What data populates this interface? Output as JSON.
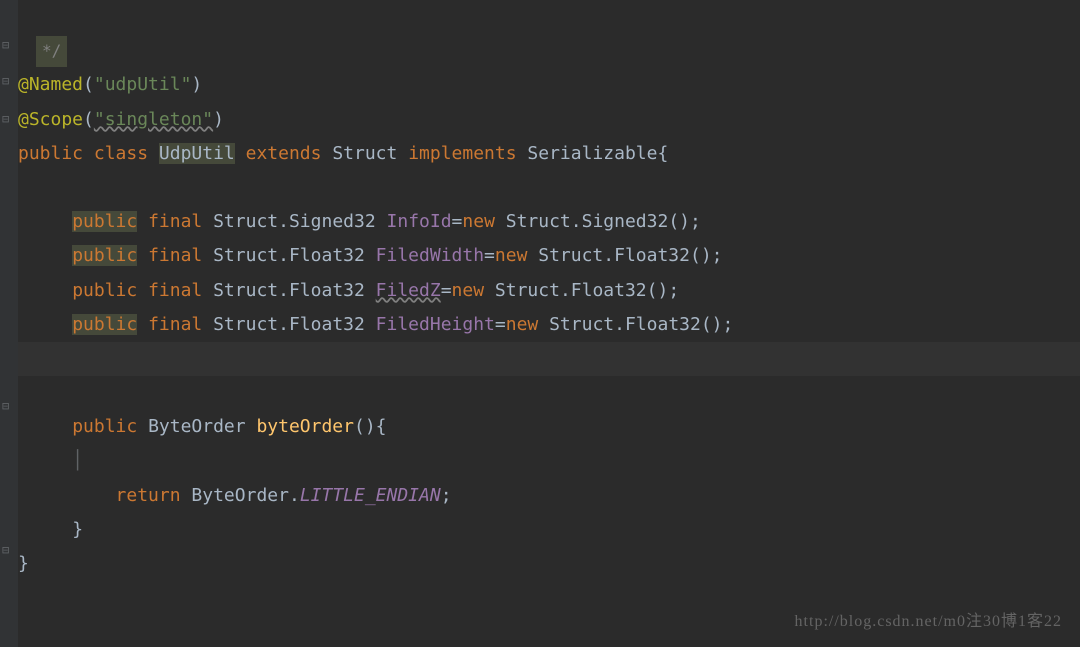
{
  "comment_fragment": "*/",
  "line_named": {
    "anno": "@Named",
    "open": "(",
    "str": "\"udpUtil\"",
    "close": ")"
  },
  "line_scope": {
    "anno": "@Scope",
    "open": "(",
    "str": "\"singleton\"",
    "close": ")"
  },
  "class_decl": {
    "kw_public": "public",
    "kw_class": "class",
    "name": "UdpUtil",
    "kw_extends": "extends",
    "super": "Struct",
    "kw_implements": "implements",
    "iface": "Serializable",
    "brace": "{"
  },
  "fields": [
    {
      "kw_public": "public",
      "kw_public_hl": true,
      "kw_final": "final",
      "t1": "Struct",
      "dot": ".",
      "t2": "Signed32",
      "name": "InfoId",
      "eq": "=",
      "kw_new": "new",
      "ct1": "Struct",
      "cdot": ".",
      "ct2": "Signed32",
      "tail": "();"
    },
    {
      "kw_public": "public",
      "kw_public_hl": true,
      "kw_final": "final",
      "t1": "Struct",
      "dot": ".",
      "t2": "Float32",
      "name": "FiledWidth",
      "eq": "=",
      "kw_new": "new",
      "ct1": "Struct",
      "cdot": ".",
      "ct2": "Float32",
      "tail": "();"
    },
    {
      "kw_public": "public",
      "kw_public_hl": false,
      "kw_final": "final",
      "t1": "Struct",
      "dot": ".",
      "t2": "Float32",
      "name": "FiledZ",
      "name_wavy": true,
      "eq": "=",
      "kw_new": "new",
      "ct1": "Struct",
      "cdot": ".",
      "ct2": "Float32",
      "tail": "();"
    },
    {
      "kw_public": "public",
      "kw_public_hl": true,
      "kw_final": "final",
      "t1": "Struct",
      "dot": ".",
      "t2": "Float32",
      "name": "FiledHeight",
      "eq": "=",
      "kw_new": "new",
      "ct1": "Struct",
      "cdot": ".",
      "ct2": "Float32",
      "tail": "();"
    }
  ],
  "method": {
    "kw_public": "public",
    "ret": "ByteOrder",
    "name": "byteOrder",
    "sig": "(){",
    "kw_return": "return",
    "cls": "ByteOrder",
    "dot": ".",
    "constant": "LITTLE_ENDIAN",
    "semi": ";",
    "close": "}"
  },
  "class_close": "}",
  "watermark": "http://blog.csdn.net/m0注30博1客22"
}
